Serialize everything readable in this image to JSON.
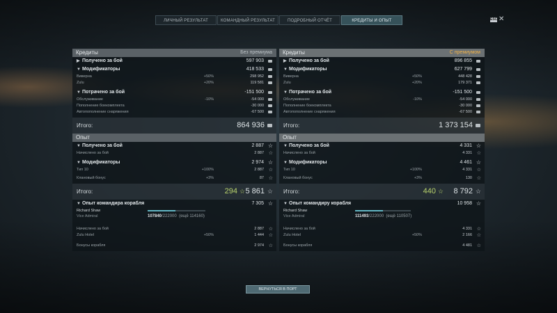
{
  "tabs": [
    "ЛИЧНЫЙ РЕЗУЛЬТАТ",
    "КОМАНДНЫЙ РЕЗУЛЬТАТ",
    "ПОДРОБНЫЙ ОТЧЁТ",
    "КРЕДИТЫ И ОПЫТ"
  ],
  "active_tab": 3,
  "esc_badge": "ESC",
  "left": {
    "credits_header": "Кредиты",
    "credits_mode": "Без премиума",
    "earned_label": "Получено за бой",
    "earned_value": "597 903",
    "modifiers_label": "Модификаторы",
    "modifiers_value": "418 533",
    "mod_rows": [
      {
        "label": "Виверна",
        "pct": "+50%",
        "value": "298 952"
      },
      {
        "label": "Zulu",
        "pct": "+20%",
        "value": "119 581"
      }
    ],
    "spent_label": "Потрачено за бой",
    "spent_value": "-151 500",
    "spent_rows": [
      {
        "label": "Обслуживание",
        "pct": "-10%",
        "value": "-54 000"
      },
      {
        "label": "Пополнение боекомплекта",
        "pct": "",
        "value": "-30 000"
      },
      {
        "label": "Автопополнение снаряжения",
        "pct": "",
        "value": "-67 500"
      }
    ],
    "credits_total_label": "Итого:",
    "credits_total": "864 936",
    "xp_header": "Опыт",
    "xp_earned_label": "Получено за бой",
    "xp_earned_value": "2 887",
    "xp_earned_rows": [
      {
        "label": "Начислено за бой",
        "pct": "",
        "value": "2 887"
      }
    ],
    "xp_mod_label": "Модификаторы",
    "xp_mod_value": "2 974",
    "xp_mod_rows": [
      {
        "label": "Тип 10",
        "pct": "+100%",
        "value": "2 887"
      },
      {
        "label": "Клановый бонус",
        "pct": "+3%",
        "value": "87"
      }
    ],
    "xp_total_label": "Итого:",
    "xp_total_free": "294",
    "xp_total": "5 861",
    "cdr_label": "Опыт командира корабля",
    "cdr_value": "7 305",
    "cdr_name": "Richard Shaw",
    "cdr_rank": "Vice Admiral",
    "cdr_xp": "107840",
    "cdr_xp_max": "/222000",
    "cdr_xp_left": "(ещё 114160)",
    "cdr_progress": 0.486,
    "cdr_rows": [
      {
        "label": "Начислено за бой",
        "pct": "",
        "value": "2 887"
      },
      {
        "label": "Zulu Hotel",
        "pct": "+50%",
        "value": "1 444"
      }
    ],
    "ship_bonus_label": "Бонусы корабля",
    "ship_bonus_value": "2 974"
  },
  "right": {
    "credits_header": "Кредиты",
    "credits_mode": "С премиумом",
    "earned_label": "Получено за бой",
    "earned_value": "896 855",
    "modifiers_label": "Модификаторы",
    "modifiers_value": "627 799",
    "mod_rows": [
      {
        "label": "Виверна",
        "pct": "+50%",
        "value": "448 428"
      },
      {
        "label": "Zulu",
        "pct": "+20%",
        "value": "179 371"
      }
    ],
    "spent_label": "Потрачено за бой",
    "spent_value": "-151 500",
    "spent_rows": [
      {
        "label": "Обслуживание",
        "pct": "-10%",
        "value": "-54 000"
      },
      {
        "label": "Пополнение боекомплекта",
        "pct": "",
        "value": "-30 000"
      },
      {
        "label": "Автопополнение снаряжения",
        "pct": "",
        "value": "-67 500"
      }
    ],
    "credits_total_label": "Итого:",
    "credits_total": "1 373 154",
    "xp_header": "Опыт",
    "xp_earned_label": "Получено за бой",
    "xp_earned_value": "4 331",
    "xp_earned_rows": [
      {
        "label": "Начислено за бой",
        "pct": "",
        "value": "4 331"
      }
    ],
    "xp_mod_label": "Модификаторы",
    "xp_mod_value": "4 461",
    "xp_mod_rows": [
      {
        "label": "Тип 10",
        "pct": "+100%",
        "value": "4 331"
      },
      {
        "label": "Клановый бонус",
        "pct": "+3%",
        "value": "130"
      }
    ],
    "xp_total_label": "Итого:",
    "xp_total_free": "440",
    "xp_total": "8 792",
    "cdr_label": "Опыт командиру корабля",
    "cdr_value": "10 958",
    "cdr_name": "Richard Shaw",
    "cdr_rank": "Vice Admiral",
    "cdr_xp": "111493",
    "cdr_xp_max": "/222000",
    "cdr_xp_left": "(ещё 110507)",
    "cdr_progress": 0.502,
    "cdr_rows": [
      {
        "label": "Начислено за бой",
        "pct": "",
        "value": "4 331"
      },
      {
        "label": "Zulu Hotel",
        "pct": "+50%",
        "value": "2 166"
      }
    ],
    "ship_bonus_label": "Бонусы корабля",
    "ship_bonus_value": "4 481"
  },
  "back_button": "ВЕРНУТЬСЯ В ПОРТ"
}
